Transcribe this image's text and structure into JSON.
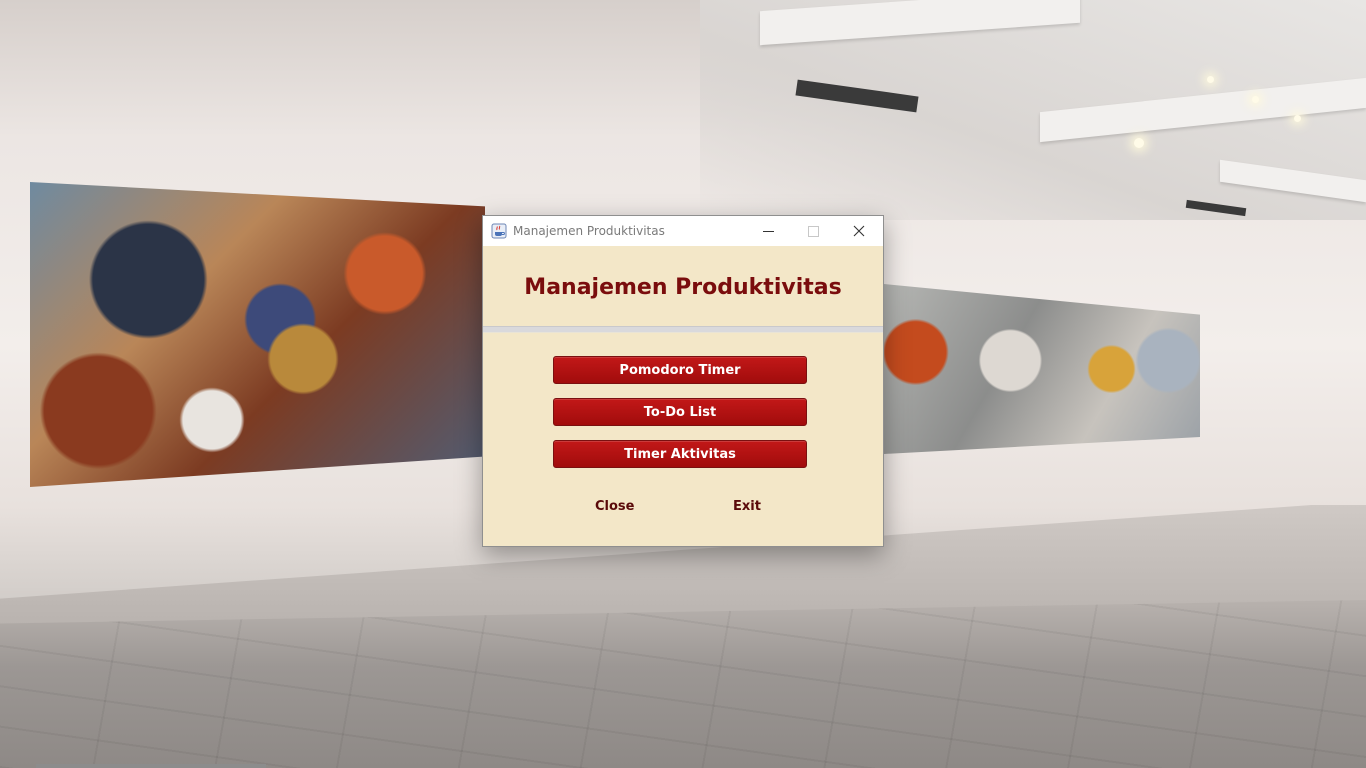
{
  "window": {
    "title": "Manajemen Produktivitas",
    "heading": "Manajemen Produktivitas"
  },
  "menu": {
    "items": [
      {
        "label": "Pomodoro Timer"
      },
      {
        "label": "To-Do List"
      },
      {
        "label": "Timer Aktivitas"
      }
    ],
    "close_label": "Close",
    "exit_label": "Exit"
  },
  "colors": {
    "window_background": "#f3e7c8",
    "heading_text": "#7a0d0d",
    "button_red": "#b01212",
    "button_text": "#ffffff",
    "link_text": "#5a0a0a"
  },
  "icons": {
    "app": "java-coffee-icon",
    "minimize": "minimize-icon",
    "maximize": "maximize-icon",
    "close": "close-icon"
  }
}
